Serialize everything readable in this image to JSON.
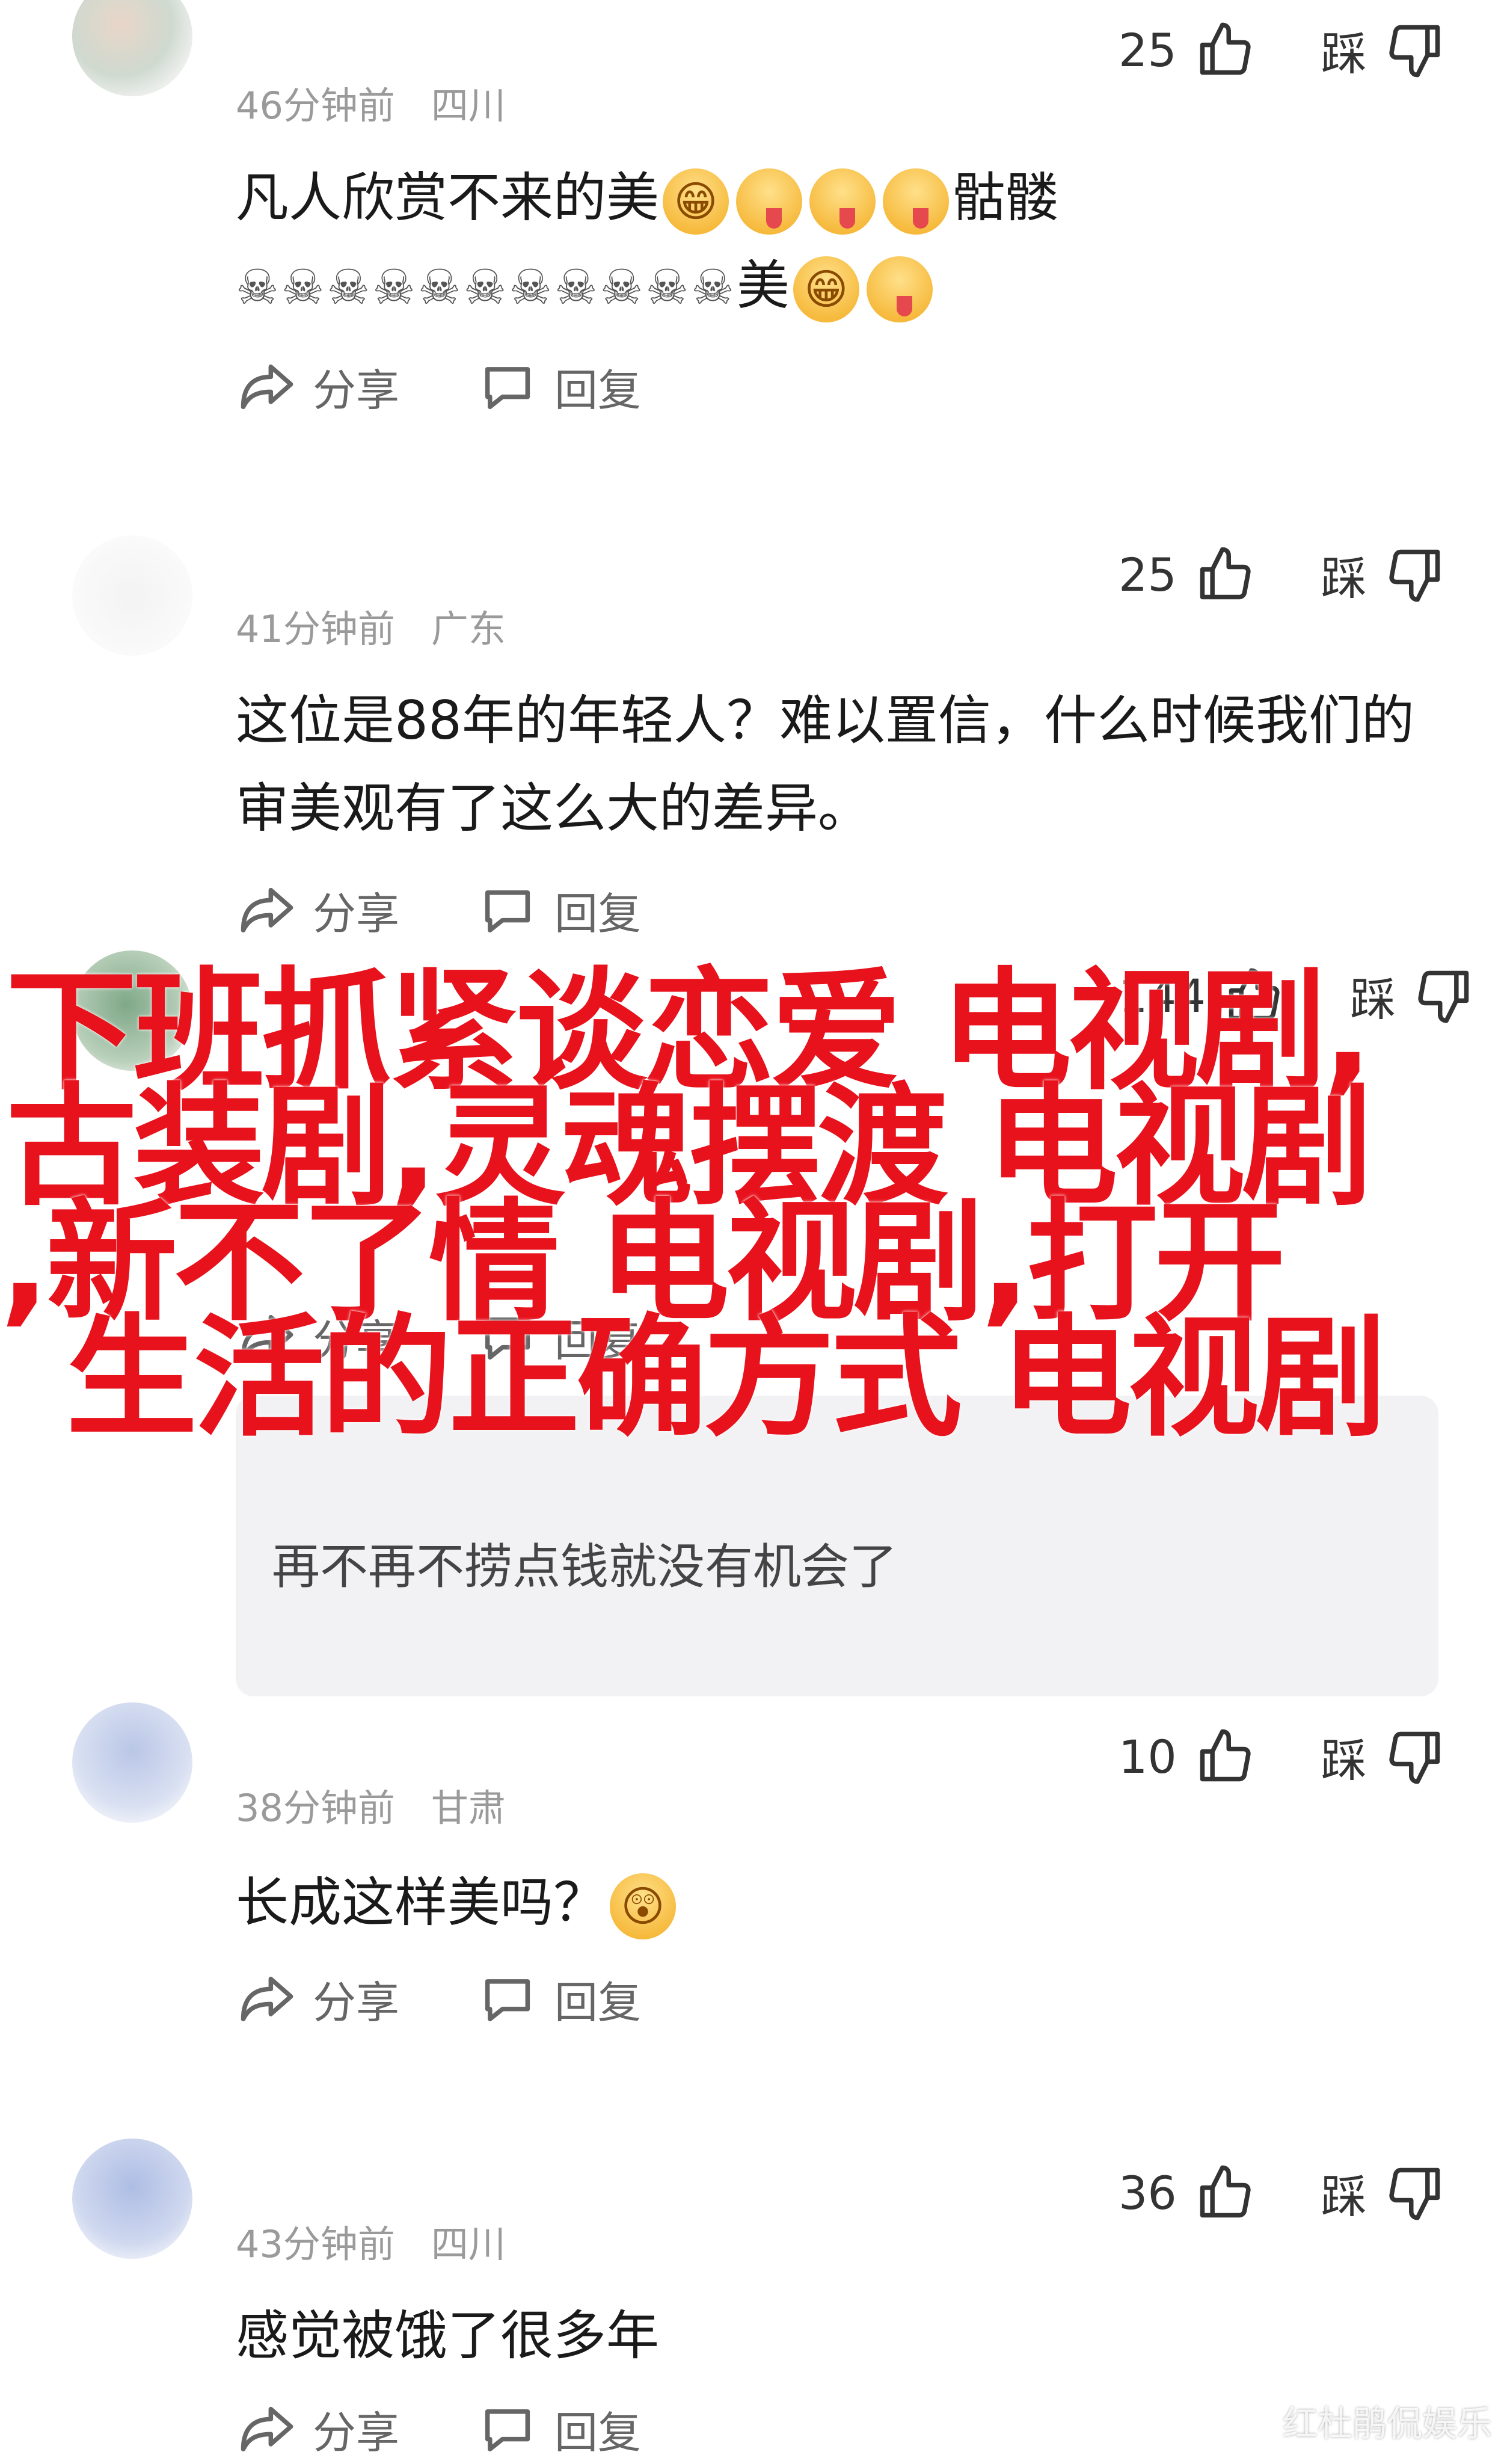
{
  "comments": [
    {
      "username": "",
      "time": "46分钟前",
      "location": "四川",
      "line1_text": "凡人欣赏不来的美",
      "line1_tail": "骷髅",
      "line2_skulls": "☠☠☠☠☠☠☠☠☠☠☠",
      "line2_text": "美",
      "likes": "25",
      "dislike_label": "踩",
      "share_label": "分享",
      "reply_label": "回复"
    },
    {
      "username": "",
      "time": "41分钟前",
      "location": "广东",
      "text": "这位是88年的年轻人？难以置信，什么时候我们的审美观有了这么大的差异。",
      "likes": "25",
      "dislike_label": "踩",
      "share_label": "分享",
      "reply_label": "回复"
    },
    {
      "username": "",
      "time": "",
      "location": "",
      "text": "",
      "likes": "144",
      "dislike_label": "踩",
      "share_label": "分享",
      "reply_label": "回复",
      "quote_line1": "",
      "quote_line2": "再不再不捞点钱就没有机会了"
    },
    {
      "username": "",
      "time": "38分钟前",
      "location": "甘肃",
      "text": "长成这样美吗？",
      "likes": "10",
      "dislike_label": "踩",
      "share_label": "分享",
      "reply_label": "回复"
    },
    {
      "username": "",
      "time": "43分钟前",
      "location": "四川",
      "text": "感觉被饿了很多年",
      "likes": "36",
      "dislike_label": "踩",
      "share_label": "分享",
      "reply_label": "回复"
    }
  ],
  "overlay": {
    "line1": "下班抓紧谈恋爱 电视剧,",
    "line2": "古装剧,灵魂摆渡 电视剧",
    "line3": ",新不了情 电视剧,打开",
    "line4": "生活的正确方式 电视剧",
    "color": "#e8121d"
  },
  "watermark": "红杜鹃侃娱乐"
}
